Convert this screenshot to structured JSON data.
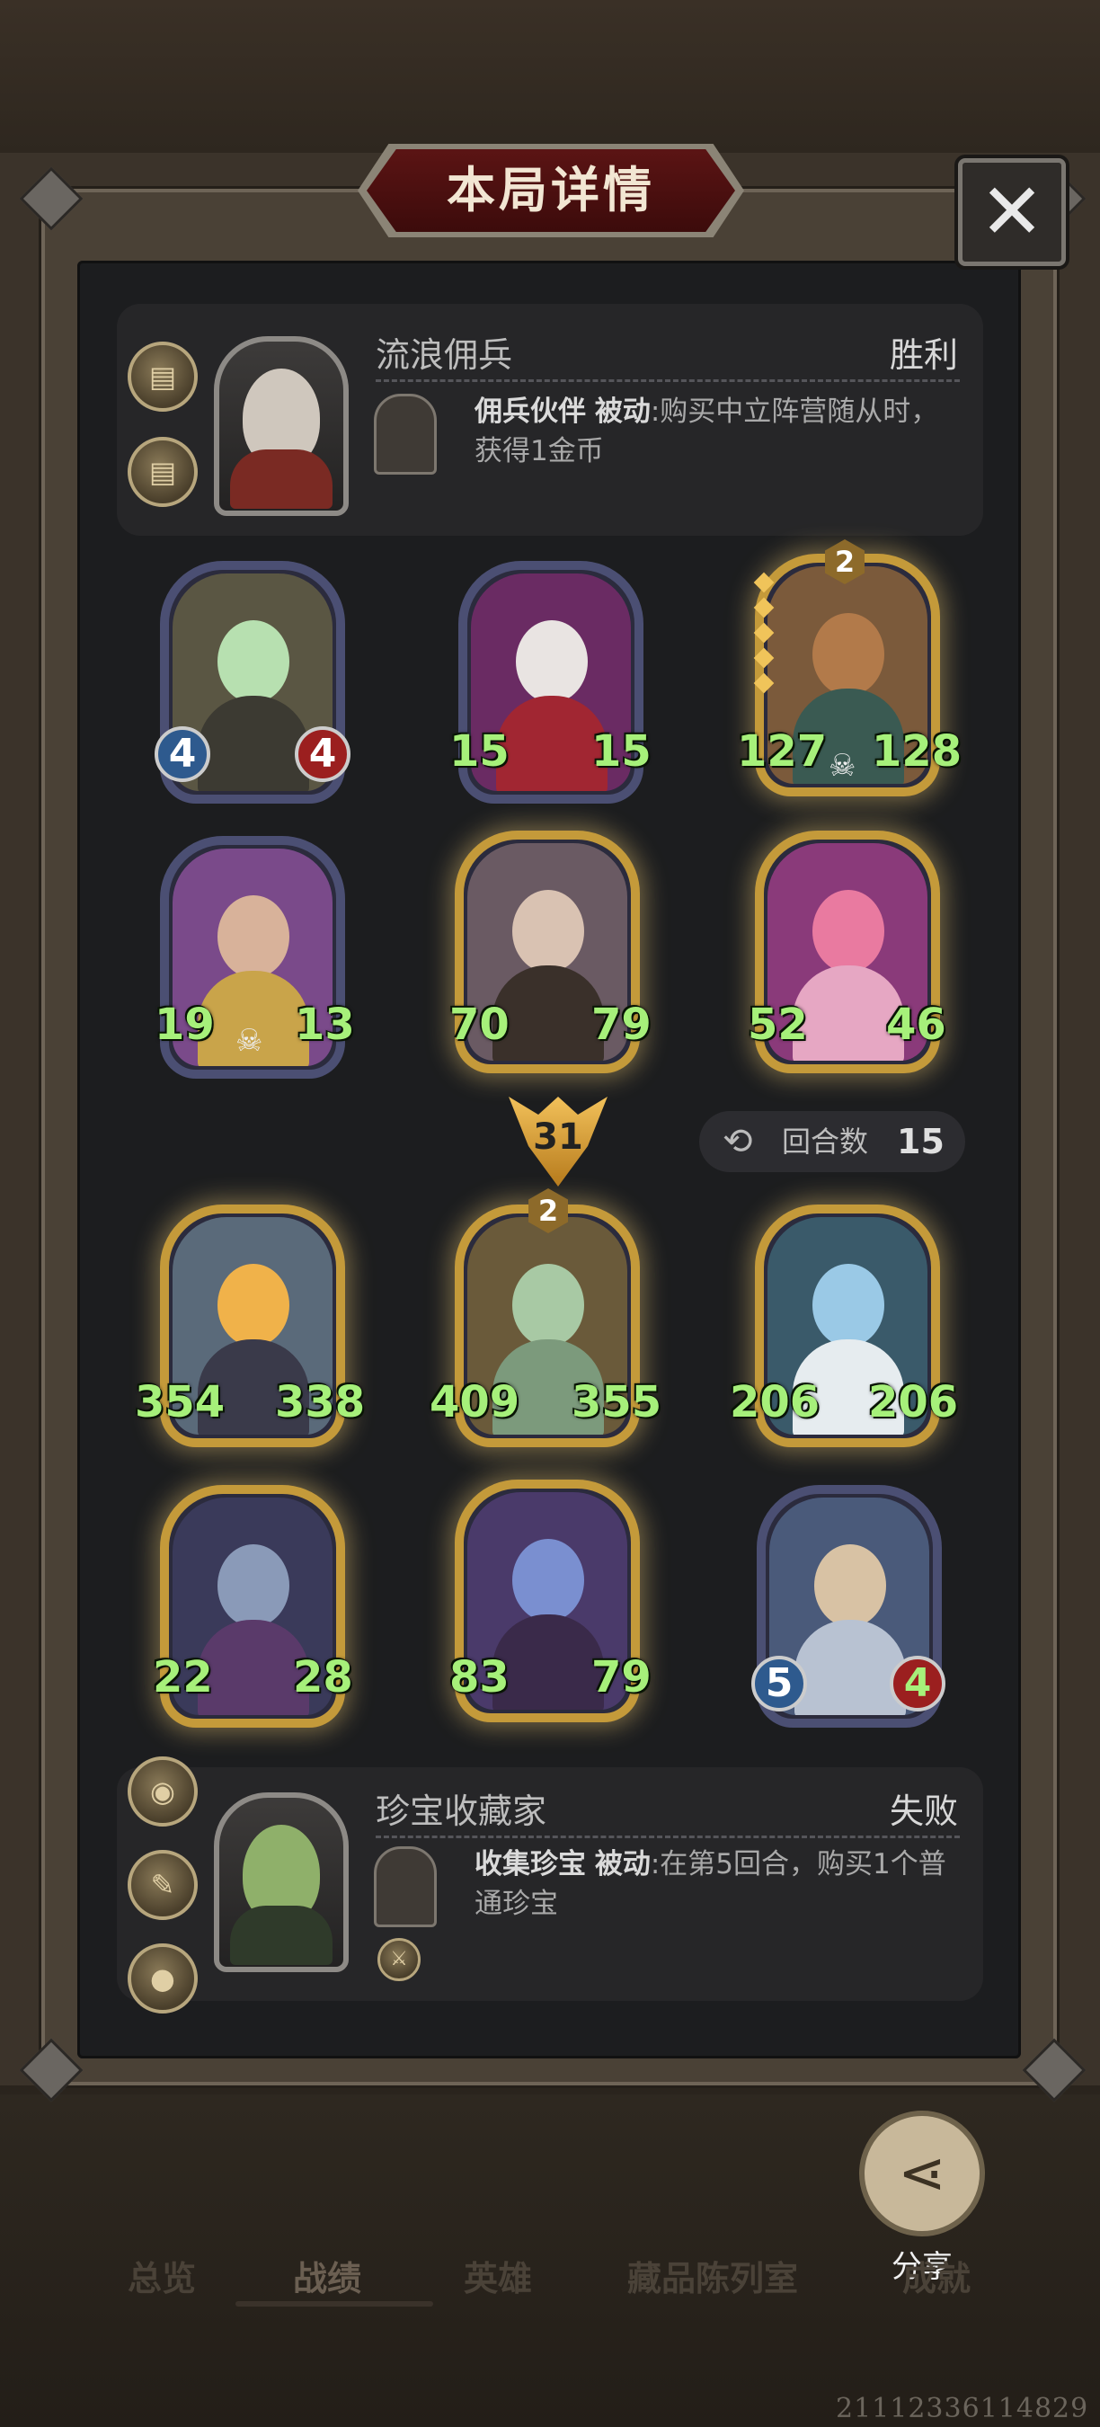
{
  "dialog": {
    "title": "本局详情",
    "close_icon": "close-icon"
  },
  "player_top": {
    "name": "流浪佣兵",
    "result": "胜利",
    "hero_power_name": "佣兵伙伴",
    "hero_power_type": "被动",
    "hero_power_desc": ":购买中立阵营随从时，获得1金币",
    "trinkets": [
      "book-icon",
      "book-icon"
    ]
  },
  "round": {
    "label": "回合数",
    "value": "15",
    "damage": "31"
  },
  "board_top": [
    {
      "atk": "4",
      "hp": "4"
    },
    {
      "atk": "15",
      "hp": "15"
    },
    {
      "atk": "127",
      "hp": "128",
      "tier": "2"
    },
    {
      "atk": "19",
      "hp": "13"
    },
    {
      "atk": "70",
      "hp": "79"
    },
    {
      "atk": "52",
      "hp": "46"
    }
  ],
  "board_bottom": [
    {
      "atk": "354",
      "hp": "338"
    },
    {
      "atk": "409",
      "hp": "355",
      "tier": "2"
    },
    {
      "atk": "206",
      "hp": "206"
    },
    {
      "atk": "22",
      "hp": "28"
    },
    {
      "atk": "83",
      "hp": "79"
    },
    {
      "atk": "5",
      "hp": "4"
    }
  ],
  "player_bottom": {
    "name": "珍宝收藏家",
    "result": "失败",
    "hero_power_name": "收集珍宝",
    "hero_power_type": "被动",
    "hero_power_desc": ":在第5回合，购买1个普通珍宝",
    "trinkets": [
      "fishbowl-icon",
      "scroll-icon",
      "orb-icon"
    ]
  },
  "share": {
    "label": "分享"
  },
  "nav": {
    "items": [
      "总览",
      "战绩",
      "英雄",
      "藏品陈列室",
      "成就"
    ],
    "active_index": 1
  },
  "watermark": "21112336114829"
}
